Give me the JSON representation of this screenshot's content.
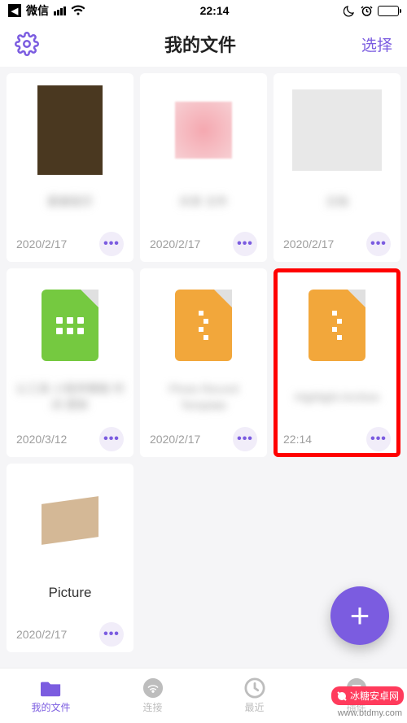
{
  "status": {
    "carrier": "微信",
    "time": "22:14"
  },
  "header": {
    "title": "我的文件",
    "select": "选择"
  },
  "files": [
    {
      "name": "蒙娜丽莎",
      "date": "2020/2/17",
      "thumb": "mona"
    },
    {
      "name": "共享 文件",
      "date": "2020/2/17",
      "thumb": "pink"
    },
    {
      "name": "文档",
      "date": "2020/2/17",
      "thumb": "doclines"
    },
    {
      "name": "认工具 小程序模板 时间 更新",
      "date": "2020/3/12",
      "thumb": "green"
    },
    {
      "name": "Photo Record Template",
      "date": "2020/2/17",
      "thumb": "orange"
    },
    {
      "name": "Highlight Archive",
      "date": "22:14",
      "thumb": "orange",
      "highlight": true
    },
    {
      "name": "Picture",
      "date": "2020/2/17",
      "thumb": "box",
      "clear": true
    }
  ],
  "nav": {
    "files": "我的文件",
    "connect": "连接",
    "recent": "最近",
    "plugins": "插件"
  },
  "watermark": {
    "site": "冰糖安卓网",
    "url": "www.btdmy.com"
  }
}
